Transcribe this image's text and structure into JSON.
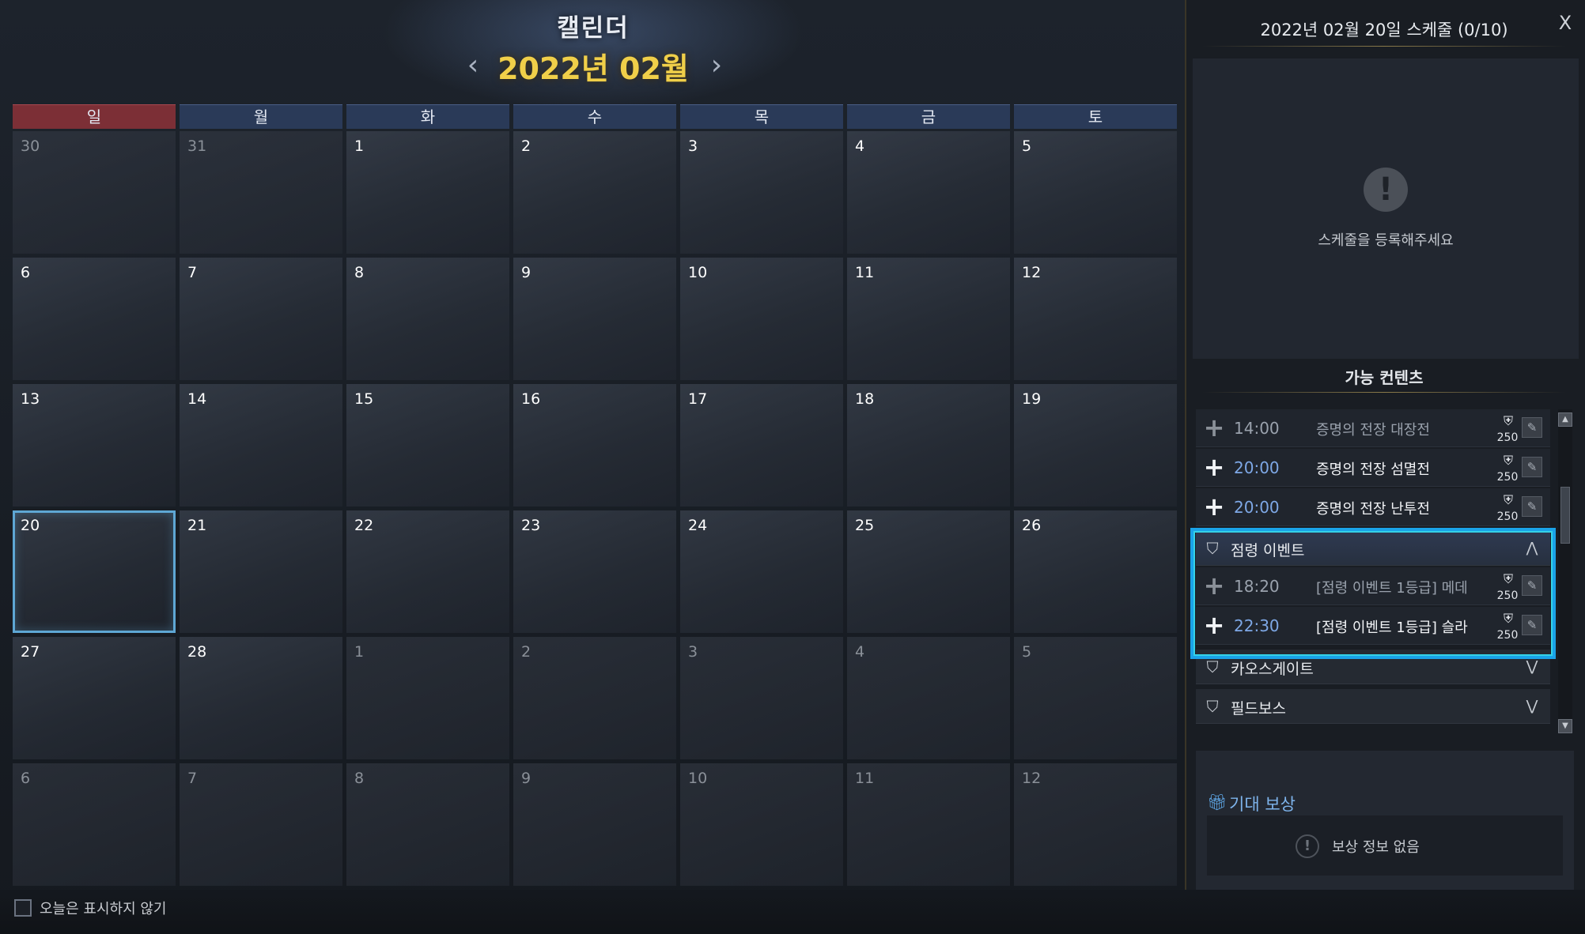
{
  "calendar": {
    "title": "캘린더",
    "month_label": "2022년 02월",
    "prev_icon": "chevron-left-icon",
    "next_icon": "chevron-right-icon",
    "prev_glyph": "‹",
    "next_glyph": "›",
    "weekdays": [
      "일",
      "월",
      "화",
      "수",
      "목",
      "금",
      "토"
    ],
    "days": [
      {
        "n": "30",
        "other": true
      },
      {
        "n": "31",
        "other": true
      },
      {
        "n": "1"
      },
      {
        "n": "2"
      },
      {
        "n": "3"
      },
      {
        "n": "4"
      },
      {
        "n": "5"
      },
      {
        "n": "6"
      },
      {
        "n": "7"
      },
      {
        "n": "8"
      },
      {
        "n": "9"
      },
      {
        "n": "10"
      },
      {
        "n": "11"
      },
      {
        "n": "12"
      },
      {
        "n": "13"
      },
      {
        "n": "14"
      },
      {
        "n": "15"
      },
      {
        "n": "16"
      },
      {
        "n": "17"
      },
      {
        "n": "18"
      },
      {
        "n": "19"
      },
      {
        "n": "20",
        "selected": true
      },
      {
        "n": "21"
      },
      {
        "n": "22"
      },
      {
        "n": "23"
      },
      {
        "n": "24"
      },
      {
        "n": "25"
      },
      {
        "n": "26"
      },
      {
        "n": "27"
      },
      {
        "n": "28"
      },
      {
        "n": "1",
        "other": true
      },
      {
        "n": "2",
        "other": true
      },
      {
        "n": "3",
        "other": true
      },
      {
        "n": "4",
        "other": true
      },
      {
        "n": "5",
        "other": true
      },
      {
        "n": "6",
        "other": true
      },
      {
        "n": "7",
        "other": true
      },
      {
        "n": "8",
        "other": true
      },
      {
        "n": "9",
        "other": true
      },
      {
        "n": "10",
        "other": true
      },
      {
        "n": "11",
        "other": true
      },
      {
        "n": "12",
        "other": true
      }
    ],
    "hide_today_label": "오늘은 표시하지 않기"
  },
  "panel": {
    "title": "2022년 02월 20일 스케줄 (0/10)",
    "close_label": "X",
    "empty_icon": "!",
    "empty_message": "스케줄을 등록해주세요",
    "available_title": "가능 컨텐츠",
    "items": [
      {
        "time": "14:00",
        "name": "증명의 전장 대장전",
        "level": "250",
        "active": false
      },
      {
        "time": "20:00",
        "name": "증명의 전장 섬멸전",
        "level": "250",
        "active": true
      },
      {
        "time": "20:00",
        "name": "증명의 전장 난투전",
        "level": "250",
        "active": true
      }
    ],
    "event_category": {
      "label": "점령 이벤트",
      "icon": "shield-crest-icon",
      "expanded": true,
      "items": [
        {
          "time": "18:20",
          "name": "[점령 이벤트 1등급] 메데",
          "level": "250",
          "active": false
        },
        {
          "time": "22:30",
          "name": "[점령 이벤트 1등급] 슬라",
          "level": "250",
          "active": true
        }
      ]
    },
    "categories": [
      {
        "label": "카오스게이트",
        "icon": "chaos-gate-icon"
      },
      {
        "label": "필드보스",
        "icon": "field-boss-icon"
      }
    ],
    "plus_glyph": "+",
    "helm_glyph": "⛨",
    "edit_glyph": "✎",
    "chevron_up": "⋀",
    "chevron_down": "⋁",
    "reward": {
      "title": "기대 보상",
      "icon": "gift-icon",
      "warn_icon": "!",
      "message": "보상 정보 없음"
    }
  },
  "colors": {
    "accent_gold": "#f0cf49",
    "highlight_blue": "#1aa3e8",
    "sunday_red": "#7c2f36",
    "weekday_blue": "#2a3a58",
    "active_time_blue": "#7ea8e6"
  }
}
